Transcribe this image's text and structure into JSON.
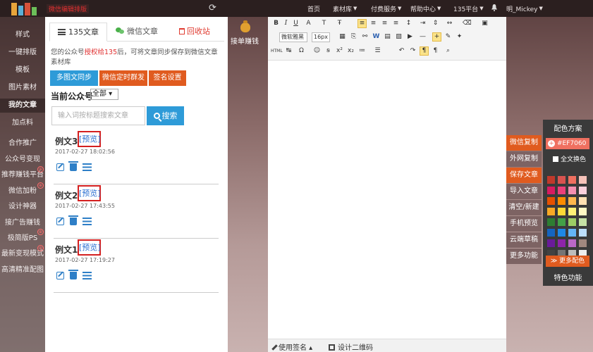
{
  "topbar": {
    "slogan": "微信编辑排版",
    "nav": [
      {
        "label": "首页",
        "dropdown": false
      },
      {
        "label": "素材库",
        "dropdown": true
      },
      {
        "label": "付费服务",
        "dropdown": true
      },
      {
        "label": "帮助中心",
        "dropdown": true
      },
      {
        "label": "135平台",
        "dropdown": true
      },
      {
        "label": "明_Mickey",
        "dropdown": true
      }
    ]
  },
  "sidebar": {
    "items": [
      {
        "label": "样式"
      },
      {
        "label": "一键排版"
      },
      {
        "label": "模板"
      },
      {
        "label": "图片素材"
      },
      {
        "label": "我的文章",
        "active": true
      },
      {
        "label": "加点料"
      },
      {
        "label": "合作推广"
      },
      {
        "label": "公众号变现"
      },
      {
        "label": "推荐赚钱平台"
      },
      {
        "label": "微信加粉"
      },
      {
        "label": "设计神器"
      },
      {
        "label": "接广告赚钱"
      },
      {
        "label": "极简版PS"
      },
      {
        "label": "最新变现模式"
      },
      {
        "label": "高清精准配图"
      }
    ]
  },
  "panel": {
    "tabs": {
      "articles": "135文章",
      "wechat": "微信文章",
      "recycle": "回收站"
    },
    "sync_tip": {
      "before": "您的公众号",
      "highlight": "授权给135",
      "after": "后，可将文章同步保存到微信文章素材库"
    },
    "buttons": {
      "sync": "多图文同步",
      "timer": "微信定时群发",
      "sign": "签名设置"
    },
    "account_label": "当前公众号",
    "account_select": "全部",
    "search_placeholder": "输入词按标题搜索文章",
    "search_button": "搜索",
    "preview_label": "[预览]",
    "articles": [
      {
        "title": "例文3",
        "date": "2017-02-27 18:02:56"
      },
      {
        "title": "例文2",
        "date": "2017-02-27 17:43:55"
      },
      {
        "title": "例文1",
        "date": "2017-02-27 17:19:27"
      }
    ]
  },
  "middle": {
    "earn_label": "接单赚钱"
  },
  "toolbar": {
    "font_family": "微软雅黑",
    "font_size": "16px"
  },
  "editor_footer": {
    "signature": "使用签名",
    "qrcode": "设计二维码"
  },
  "actions": [
    "微信复制",
    "外网复制",
    "保存文章",
    "导入文章",
    "清空/新建",
    "手机预览",
    "云端草稿",
    "更多功能"
  ],
  "scheme": {
    "title": "配色方案",
    "current_color": "#EF7060",
    "checkbox": "全文换色",
    "more": "更多配色",
    "footer": "特色功能",
    "swatches": [
      "#c0392b",
      "#d9534f",
      "#ef7060",
      "#f6c2b9",
      "#d81b60",
      "#ec407a",
      "#f48fb1",
      "#fbd0dc",
      "#e65100",
      "#fb8c00",
      "#ffb74d",
      "#ffe0b2",
      "#f9a825",
      "#fdd835",
      "#fff176",
      "#fff9c4",
      "#2e7d32",
      "#43a047",
      "#9ccc65",
      "#c5e1a5",
      "#1565c0",
      "#1e88e5",
      "#64b5f6",
      "#bbdefb",
      "#6a1b9a",
      "#8e24aa",
      "#ba68c8",
      "#a1887f",
      "#424242",
      "#757575",
      "#bdbdbd",
      "#eeeeee"
    ]
  }
}
